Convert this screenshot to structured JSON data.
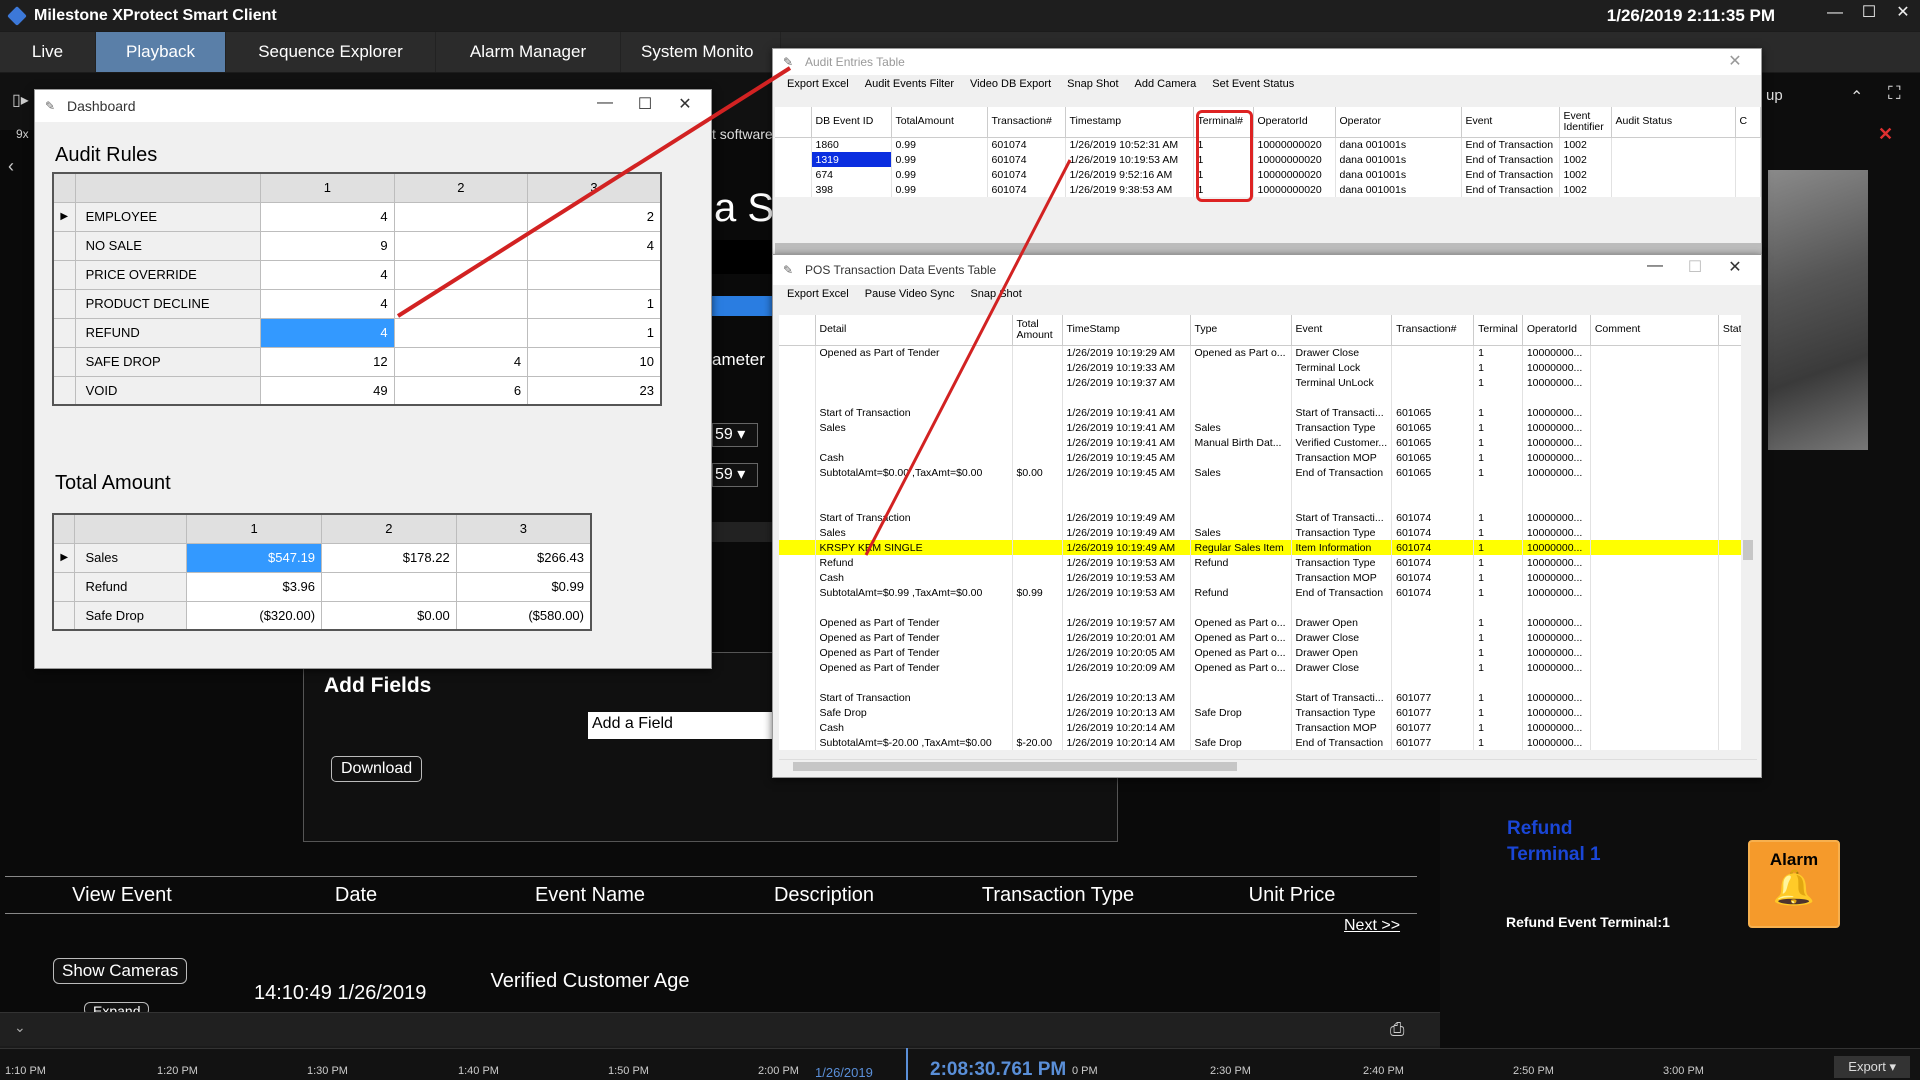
{
  "app": {
    "title": "Milestone XProtect Smart Client",
    "clock": "1/26/2019 2:11:35 PM"
  },
  "window_controls": {
    "minimize": "—",
    "maximize": "☐",
    "close": "✕"
  },
  "tabs": [
    {
      "label": "Live"
    },
    {
      "label": "Playback"
    },
    {
      "label": "Sequence Explorer"
    },
    {
      "label": "Alarm Manager"
    },
    {
      "label": "System Monito"
    }
  ],
  "background": {
    "partial_texts": [
      "a S",
      "ameter",
      "59",
      "59",
      "t software",
      "up",
      "9x"
    ],
    "add_fields_title": "Add Fields",
    "add_field_placeholder": "Add a Field",
    "download": "Download",
    "event_columns": [
      "View Event",
      "Date",
      "Event Name",
      "Description",
      "Transaction Type",
      "Unit Price"
    ],
    "next": "Next >>",
    "show_cameras": "Show Cameras",
    "expand": "Expand",
    "event_time": "14:10:49 1/26/2019",
    "event_name": "Verified Customer Age"
  },
  "timeline": {
    "labels": [
      "1:10 PM",
      "1:20 PM",
      "1:30 PM",
      "1:40 PM",
      "1:50 PM",
      "2:00 PM",
      "0 PM",
      "2:30 PM",
      "2:40 PM",
      "2:50 PM",
      "3:00 PM"
    ],
    "date": "1/26/2019",
    "current_time": "2:08:30.761 PM",
    "export": "Export ▾"
  },
  "right_panel": {
    "refund_line1": "Refund",
    "refund_line2": "Terminal 1",
    "refund_event": "Refund Event Terminal:1",
    "alarm_label": "Alarm"
  },
  "dashboard": {
    "title": "Dashboard",
    "audit_rules_heading": "Audit Rules",
    "audit_cols": [
      "1",
      "2",
      "3"
    ],
    "audit_rows": [
      {
        "name": "EMPLOYEE",
        "v": [
          "4",
          "",
          "2"
        ]
      },
      {
        "name": "NO SALE",
        "v": [
          "9",
          "",
          "4"
        ]
      },
      {
        "name": "PRICE OVERRIDE",
        "v": [
          "4",
          "",
          ""
        ]
      },
      {
        "name": "PRODUCT DECLINE",
        "v": [
          "4",
          "",
          "1"
        ]
      },
      {
        "name": "REFUND",
        "v": [
          "4",
          "",
          "1"
        ]
      },
      {
        "name": "SAFE DROP",
        "v": [
          "12",
          "4",
          "10"
        ]
      },
      {
        "name": "VOID",
        "v": [
          "49",
          "6",
          "23"
        ]
      }
    ],
    "total_amount_heading": "Total Amount",
    "total_cols": [
      "1",
      "2",
      "3"
    ],
    "total_rows": [
      {
        "name": "Sales",
        "v": [
          "$547.19",
          "$178.22",
          "$266.43"
        ]
      },
      {
        "name": "Refund",
        "v": [
          "$3.96",
          "",
          "$0.99"
        ]
      },
      {
        "name": "Safe Drop",
        "v": [
          "($320.00)",
          "$0.00",
          "($580.00)"
        ]
      }
    ]
  },
  "audit_entries": {
    "title": "Audit Entries Table",
    "menu": [
      "Export Excel",
      "Audit Events Filter",
      "Video DB Export",
      "Snap Shot",
      "Add Camera",
      "Set Event Status"
    ],
    "columns": [
      "DB Event ID",
      "TotalAmount",
      "Transaction#",
      "Timestamp",
      "Terminal#",
      "OperatorId",
      "Operator",
      "Event",
      "Event Identifier",
      "Audit Status",
      "C"
    ],
    "rows": [
      [
        "1860",
        "0.99",
        "601074",
        "1/26/2019 10:52:31 AM",
        "1",
        "10000000020",
        "dana 001001s",
        "End of Transaction",
        "1002",
        ""
      ],
      [
        "1319",
        "0.99",
        "601074",
        "1/26/2019 10:19:53 AM",
        "1",
        "10000000020",
        "dana 001001s",
        "End of Transaction",
        "1002",
        ""
      ],
      [
        "674",
        "0.99",
        "601074",
        "1/26/2019 9:52:16 AM",
        "1",
        "10000000020",
        "dana 001001s",
        "End of Transaction",
        "1002",
        ""
      ],
      [
        "398",
        "0.99",
        "601074",
        "1/26/2019 9:38:53 AM",
        "1",
        "10000000020",
        "dana 001001s",
        "End of Transaction",
        "1002",
        ""
      ]
    ]
  },
  "pos_table": {
    "title": "POS Transaction Data Events Table",
    "menu": [
      "Export Excel",
      "Pause Video Sync",
      "Snap Shot"
    ],
    "columns": [
      "Detail",
      "Total Amount",
      "TimeStamp",
      "Type",
      "Event",
      "Transaction#",
      "Terminal",
      "OperatorId",
      "Comment",
      "Stat"
    ],
    "rows": [
      [
        "Opened as Part of Tender",
        "",
        "1/26/2019 10:19:29 AM",
        "Opened as Part o...",
        "Drawer Close",
        "",
        "1",
        "10000000...",
        ""
      ],
      [
        "",
        "",
        "1/26/2019 10:19:33 AM",
        "",
        "Terminal Lock",
        "",
        "1",
        "10000000...",
        ""
      ],
      [
        "",
        "",
        "1/26/2019 10:19:37 AM",
        "",
        "Terminal UnLock",
        "",
        "1",
        "10000000...",
        ""
      ],
      [
        "",
        "",
        "",
        "",
        "",
        "",
        "",
        "",
        ""
      ],
      [
        "Start of Transaction",
        "",
        "1/26/2019 10:19:41 AM",
        "",
        "Start of Transacti...",
        "601065",
        "1",
        "10000000...",
        ""
      ],
      [
        "Sales",
        "",
        "1/26/2019 10:19:41 AM",
        "Sales",
        "Transaction Type",
        "601065",
        "1",
        "10000000...",
        ""
      ],
      [
        "",
        "",
        "1/26/2019 10:19:41 AM",
        "Manual Birth Dat...",
        "Verified Customer...",
        "601065",
        "1",
        "10000000...",
        ""
      ],
      [
        "Cash",
        "",
        "1/26/2019 10:19:45 AM",
        "",
        "Transaction MOP",
        "601065",
        "1",
        "10000000...",
        ""
      ],
      [
        "SubtotalAmt=$0.00 ,TaxAmt=$0.00",
        "$0.00",
        "1/26/2019 10:19:45 AM",
        "Sales",
        "End of Transaction",
        "601065",
        "1",
        "10000000...",
        ""
      ],
      [
        "",
        "",
        "",
        "",
        "",
        "",
        "",
        "",
        ""
      ],
      [
        "",
        "",
        "",
        "",
        "",
        "",
        "",
        "",
        ""
      ],
      [
        "Start of Transaction",
        "",
        "1/26/2019 10:19:49 AM",
        "",
        "Start of Transacti...",
        "601074",
        "1",
        "10000000...",
        ""
      ],
      [
        "Sales",
        "",
        "1/26/2019 10:19:49 AM",
        "Sales",
        "Transaction Type",
        "601074",
        "1",
        "10000000...",
        ""
      ],
      [
        "KRSPY KRM SINGLE",
        "",
        "1/26/2019 10:19:49 AM",
        "Regular Sales Item",
        "Item Information",
        "601074",
        "1",
        "10000000...",
        ""
      ],
      [
        "Refund",
        "",
        "1/26/2019 10:19:53 AM",
        "Refund",
        "Transaction Type",
        "601074",
        "1",
        "10000000...",
        ""
      ],
      [
        "Cash",
        "",
        "1/26/2019 10:19:53 AM",
        "",
        "Transaction MOP",
        "601074",
        "1",
        "10000000...",
        ""
      ],
      [
        "SubtotalAmt=$0.99 ,TaxAmt=$0.00",
        "$0.99",
        "1/26/2019 10:19:53 AM",
        "Refund",
        "End of Transaction",
        "601074",
        "1",
        "10000000...",
        ""
      ],
      [
        "",
        "",
        "",
        "",
        "",
        "",
        "",
        "",
        ""
      ],
      [
        "Opened as Part of Tender",
        "",
        "1/26/2019 10:19:57 AM",
        "Opened as Part o...",
        "Drawer Open",
        "",
        "1",
        "10000000...",
        ""
      ],
      [
        "Opened as Part of Tender",
        "",
        "1/26/2019 10:20:01 AM",
        "Opened as Part o...",
        "Drawer Close",
        "",
        "1",
        "10000000...",
        ""
      ],
      [
        "Opened as Part of Tender",
        "",
        "1/26/2019 10:20:05 AM",
        "Opened as Part o...",
        "Drawer Open",
        "",
        "1",
        "10000000...",
        ""
      ],
      [
        "Opened as Part of Tender",
        "",
        "1/26/2019 10:20:09 AM",
        "Opened as Part o...",
        "Drawer Close",
        "",
        "1",
        "10000000...",
        ""
      ],
      [
        "",
        "",
        "",
        "",
        "",
        "",
        "",
        "",
        ""
      ],
      [
        "Start of Transaction",
        "",
        "1/26/2019 10:20:13 AM",
        "",
        "Start of Transacti...",
        "601077",
        "1",
        "10000000...",
        ""
      ],
      [
        "Safe Drop",
        "",
        "1/26/2019 10:20:13 AM",
        "Safe Drop",
        "Transaction Type",
        "601077",
        "1",
        "10000000...",
        ""
      ],
      [
        "Cash",
        "",
        "1/26/2019 10:20:14 AM",
        "",
        "Transaction MOP",
        "601077",
        "1",
        "10000000...",
        ""
      ],
      [
        "SubtotalAmt=$-20.00 ,TaxAmt=$0.00",
        "$-20.00",
        "1/26/2019 10:20:14 AM",
        "Safe Drop",
        "End of Transaction",
        "601077",
        "1",
        "10000000...",
        ""
      ]
    ]
  },
  "colors": {
    "accent": "#3399ff",
    "highlight": "#ffff00",
    "annotation": "#d22222",
    "tab_active": "#5a7fa8",
    "alarm": "#f59a2b"
  }
}
